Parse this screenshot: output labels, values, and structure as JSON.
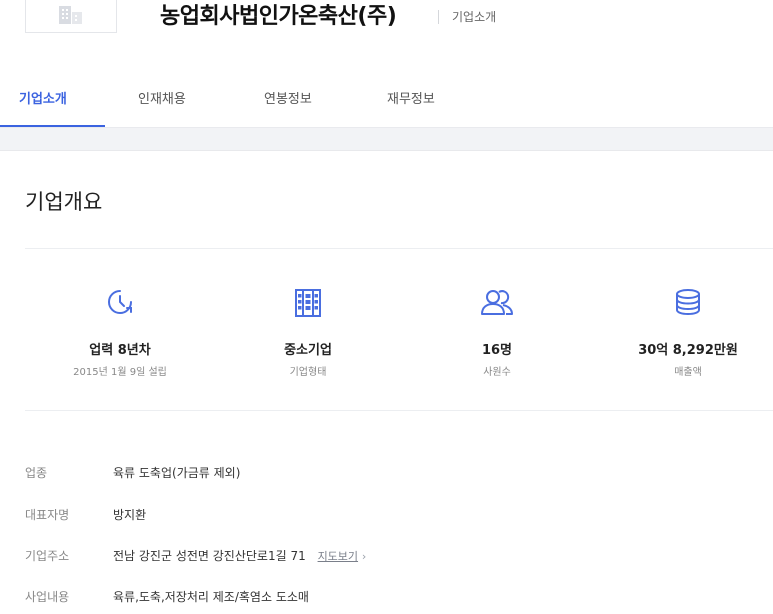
{
  "header": {
    "company_name": "농업회사법인가온축산(주)",
    "subtitle": "기업소개"
  },
  "tabs": [
    {
      "label": "기업소개",
      "active": true
    },
    {
      "label": "인재채용",
      "active": false
    },
    {
      "label": "연봉정보",
      "active": false
    },
    {
      "label": "재무정보",
      "active": false
    }
  ],
  "overview": {
    "title": "기업개요",
    "stats": [
      {
        "icon": "clock-icon",
        "value": "업력 8년차",
        "label": "2015년 1월 9일 설립"
      },
      {
        "icon": "building-icon",
        "value": "중소기업",
        "label": "기업형태"
      },
      {
        "icon": "people-icon",
        "value": "16명",
        "label": "사원수"
      },
      {
        "icon": "coins-icon",
        "value": "30억 8,292만원",
        "label": "매출액"
      }
    ]
  },
  "details": [
    {
      "key": "업종",
      "value": "육류 도축업(가금류 제외)"
    },
    {
      "key": "대표자명",
      "value": "방지환"
    },
    {
      "key": "기업주소",
      "value": "전남 강진군 성전면 강진산단로1길 71",
      "link": "지도보기",
      "link_arrow": "›"
    },
    {
      "key": "사업내용",
      "value": "육류,도축,저장처리 제조/혹염소 도소매"
    }
  ],
  "colors": {
    "accent": "#3b63e0",
    "icon": "#4a6ee0",
    "band": "#f2f3f6"
  }
}
